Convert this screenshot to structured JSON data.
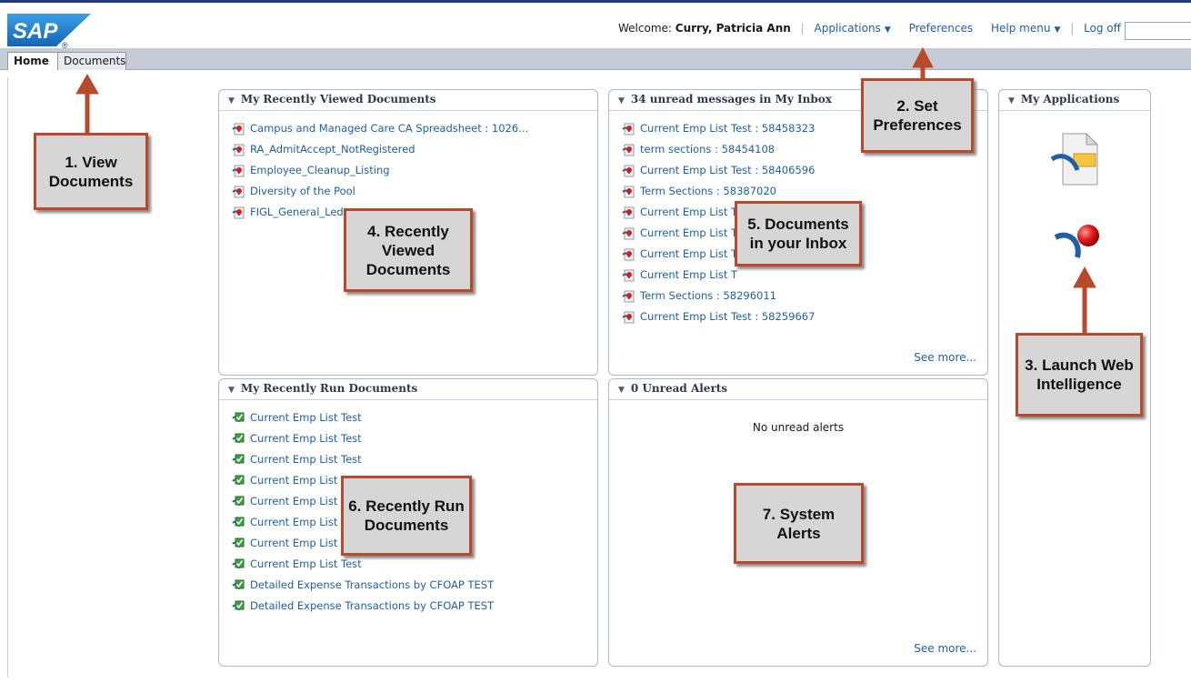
{
  "branding": {
    "logo_text": "SAP"
  },
  "header": {
    "welcome_label": "Welcome:",
    "user_name": "Curry, Patricia Ann",
    "applications_label": "Applications",
    "preferences_label": "Preferences",
    "help_label": "Help menu",
    "logoff_label": "Log off",
    "search_value": ""
  },
  "tabs": [
    {
      "label": "Home",
      "active": true
    },
    {
      "label": "Documents",
      "active": false
    }
  ],
  "recently_viewed": {
    "title": "My Recently Viewed Documents",
    "items": [
      "Campus and Managed Care CA Spreadsheet : 1026...",
      "RA_AdmitAccept_NotRegistered",
      "Employee_Cleanup_Listing",
      "Diversity of the Pool",
      "FIGL_General_Led"
    ]
  },
  "inbox": {
    "title": "34 unread messages in My Inbox",
    "items": [
      "Current Emp List Test : 58458323",
      "term sections : 58454108",
      "Current Emp List Test : 58406596",
      "Term Sections : 58387020",
      "Current Emp List T",
      "Current Emp List T",
      "Current Emp List T",
      "Current Emp List T",
      "Term Sections : 58296011",
      "Current Emp List Test : 58259667"
    ],
    "see_more": "See more..."
  },
  "recently_run": {
    "title": "My Recently Run Documents",
    "items": [
      "Current Emp List Test",
      "Current Emp List Test",
      "Current Emp List Test",
      "Current Emp List T",
      "Current Emp List T",
      "Current Emp List T",
      "Current Emp List T",
      "Current Emp List Test",
      "Detailed Expense Transactions by CFOAP TEST",
      "Detailed Expense Transactions by CFOAP TEST"
    ]
  },
  "alerts": {
    "title": "0 Unread Alerts",
    "empty_text": "No unread alerts",
    "see_more": "See more..."
  },
  "applications": {
    "title": "My Applications",
    "icons": [
      "report-document-icon",
      "web-intelligence-icon"
    ]
  },
  "callouts": {
    "c1": "1. View Documents",
    "c2": "2. Set Preferences",
    "c3": "3. Launch Web Intelligence",
    "c4": "4. Recently Viewed Documents",
    "c5": "5. Documents in your Inbox",
    "c6": "6. Recently Run Documents",
    "c7": "7. System Alerts"
  },
  "colors": {
    "brand_blue": "#1f5fa8",
    "callout_border": "#b84a2c",
    "callout_fill": "#d6d6d6",
    "tabbar": "#c5ccd6"
  }
}
